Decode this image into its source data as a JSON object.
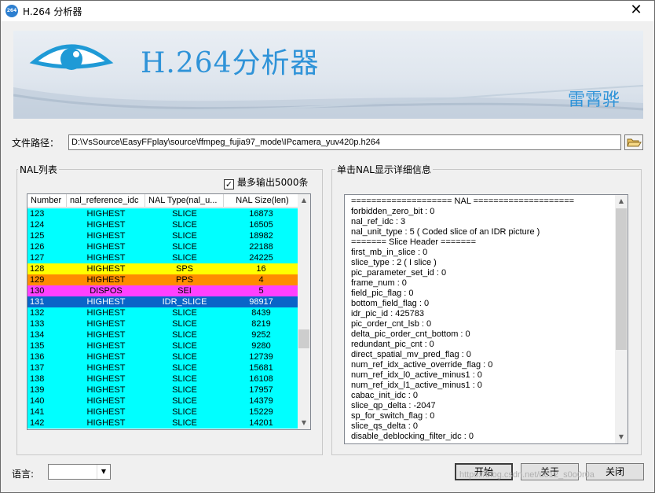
{
  "window": {
    "title": "H.264 分析器",
    "app_icon_text": "264"
  },
  "banner": {
    "title": "H.264分析器",
    "author": "雷霄骅"
  },
  "file": {
    "label": "文件路径：",
    "path": "D:\\VsSource\\EasyFFplay\\source\\ffmpeg_fujia97_mode\\IPcamera_yuv420p.h264"
  },
  "nal_group": {
    "label": "NAL列表",
    "checkbox_label": "最多输出5000条",
    "checked": true
  },
  "nal_table": {
    "columns": [
      "Number",
      "nal_reference_idc",
      "NAL Type(nal_u...",
      "NAL Size(len)"
    ],
    "rows": [
      {
        "num": "123",
        "ref": "HIGHEST",
        "type": "SLICE",
        "size": "16873",
        "color": "#00ffff",
        "text": "#000000"
      },
      {
        "num": "124",
        "ref": "HIGHEST",
        "type": "SLICE",
        "size": "16505",
        "color": "#00ffff",
        "text": "#000000"
      },
      {
        "num": "125",
        "ref": "HIGHEST",
        "type": "SLICE",
        "size": "18982",
        "color": "#00ffff",
        "text": "#000000"
      },
      {
        "num": "126",
        "ref": "HIGHEST",
        "type": "SLICE",
        "size": "22188",
        "color": "#00ffff",
        "text": "#000000"
      },
      {
        "num": "127",
        "ref": "HIGHEST",
        "type": "SLICE",
        "size": "24225",
        "color": "#00ffff",
        "text": "#000000"
      },
      {
        "num": "128",
        "ref": "HIGHEST",
        "type": "SPS",
        "size": "16",
        "color": "#ffff00",
        "text": "#000000"
      },
      {
        "num": "129",
        "ref": "HIGHEST",
        "type": "PPS",
        "size": "4",
        "color": "#ff8c00",
        "text": "#000000"
      },
      {
        "num": "130",
        "ref": "DISPOS",
        "type": "SEI",
        "size": "5",
        "color": "#ff40ff",
        "text": "#000000"
      },
      {
        "num": "131",
        "ref": "HIGHEST",
        "type": "IDR_SLICE",
        "size": "98917",
        "color": "#0a64c8",
        "text": "#ffffff"
      },
      {
        "num": "132",
        "ref": "HIGHEST",
        "type": "SLICE",
        "size": "8439",
        "color": "#00ffff",
        "text": "#000000"
      },
      {
        "num": "133",
        "ref": "HIGHEST",
        "type": "SLICE",
        "size": "8219",
        "color": "#00ffff",
        "text": "#000000"
      },
      {
        "num": "134",
        "ref": "HIGHEST",
        "type": "SLICE",
        "size": "9252",
        "color": "#00ffff",
        "text": "#000000"
      },
      {
        "num": "135",
        "ref": "HIGHEST",
        "type": "SLICE",
        "size": "9280",
        "color": "#00ffff",
        "text": "#000000"
      },
      {
        "num": "136",
        "ref": "HIGHEST",
        "type": "SLICE",
        "size": "12739",
        "color": "#00ffff",
        "text": "#000000"
      },
      {
        "num": "137",
        "ref": "HIGHEST",
        "type": "SLICE",
        "size": "15681",
        "color": "#00ffff",
        "text": "#000000"
      },
      {
        "num": "138",
        "ref": "HIGHEST",
        "type": "SLICE",
        "size": "16108",
        "color": "#00ffff",
        "text": "#000000"
      },
      {
        "num": "139",
        "ref": "HIGHEST",
        "type": "SLICE",
        "size": "17957",
        "color": "#00ffff",
        "text": "#000000"
      },
      {
        "num": "140",
        "ref": "HIGHEST",
        "type": "SLICE",
        "size": "14379",
        "color": "#00ffff",
        "text": "#000000"
      },
      {
        "num": "141",
        "ref": "HIGHEST",
        "type": "SLICE",
        "size": "15229",
        "color": "#00ffff",
        "text": "#000000"
      },
      {
        "num": "142",
        "ref": "HIGHEST",
        "type": "SLICE",
        "size": "14201",
        "color": "#00ffff",
        "text": "#000000"
      }
    ]
  },
  "detail_group": {
    "label": "单击NAL显示详细信息",
    "lines": [
      "==================== NAL ====================",
      "forbidden_zero_bit : 0",
      "nal_ref_idc : 3",
      "nal_unit_type : 5 ( Coded slice of an IDR picture )",
      "======= Slice Header =======",
      "first_mb_in_slice : 0",
      "slice_type : 2 ( I slice )",
      "pic_parameter_set_id : 0",
      "frame_num : 0",
      "field_pic_flag : 0",
      "bottom_field_flag : 0",
      "idr_pic_id : 425783",
      "pic_order_cnt_lsb : 0",
      "delta_pic_order_cnt_bottom : 0",
      "redundant_pic_cnt : 0",
      "direct_spatial_mv_pred_flag : 0",
      "num_ref_idx_active_override_flag : 0",
      "num_ref_idx_l0_active_minus1 : 0",
      "num_ref_idx_l1_active_minus1 : 0",
      "cabac_init_idc : 0",
      "slice_qp_delta : -2047",
      "sp_for_switch_flag : 0",
      "slice_qs_delta : 0",
      "disable_deblocking_filter_idc : 0"
    ]
  },
  "language": {
    "label": "语言:",
    "value": ""
  },
  "buttons": {
    "start": "开始",
    "about": "关于",
    "close": "关闭"
  },
  "watermark": "https://blog.csdn.net/u012_s0o0r0a"
}
